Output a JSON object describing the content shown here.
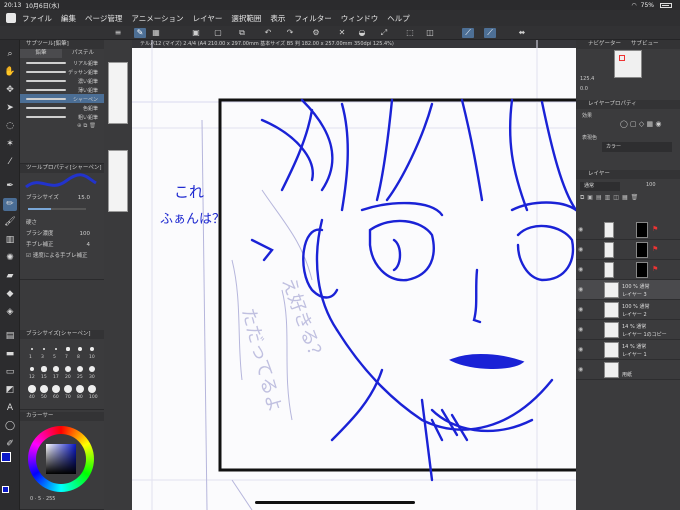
{
  "status": {
    "time": "20:13",
    "date": "10月6日(水)",
    "battery": "75%"
  },
  "menu": [
    "ファイル",
    "編集",
    "ページ管理",
    "アニメーション",
    "レイヤー",
    "選択範囲",
    "表示",
    "フィルター",
    "ウィンドウ",
    "ヘルプ"
  ],
  "doc_tab": "テルバ12 (マイズ) 2.4/4 (A4 210.00 x 297.00mm 基本サイズ B5 判 182.00 x 257.00mm 350dpi 125.4%)",
  "subtool_panel": {
    "title": "サブツール[鉛筆]",
    "tabs": [
      "鉛筆",
      "パステル"
    ],
    "brushes": [
      "リアル鉛筆",
      "デッサン鉛筆",
      "濃い鉛筆",
      "薄い鉛筆",
      "シャーペン",
      "色鉛筆",
      "粗い鉛筆"
    ]
  },
  "tool_property": {
    "title": "ツールプロパティ[シャーペン]",
    "brush_size_label": "ブラシサイズ",
    "brush_size_value": "15.0",
    "hardness_label": "硬さ",
    "density_label": "ブラシ濃度",
    "density_value": "100",
    "stabilization_label": "手ブレ補正",
    "stabilization_value": "4",
    "speed_label": "速度による手ブレ補正"
  },
  "brush_size_panel": {
    "title": "ブラシサイズ[シャーペン]",
    "sizes": [
      "1",
      "3",
      "5",
      "7",
      "8",
      "10",
      "12",
      "15",
      "17",
      "20",
      "25",
      "30",
      "40",
      "50",
      "60",
      "70",
      "80",
      "100"
    ]
  },
  "color_panel": {
    "title": "カラーサー",
    "values": [
      "0",
      "5",
      "255"
    ],
    "main_color": "#0a18c8"
  },
  "navigator": {
    "title": "ナビゲーター",
    "sub": "サブビュー",
    "zoom": "125.4",
    "angle": "0.0"
  },
  "layer_property": {
    "title": "レイヤープロパティ",
    "effect_label": "効果",
    "expression_label": "表現色",
    "expression_value": "カラー"
  },
  "layer_panel": {
    "title": "レイヤー",
    "blend_mode": "通常",
    "opacity": "100",
    "layers": [
      {
        "line1": "",
        "line2": ""
      },
      {
        "line1": "",
        "line2": ""
      },
      {
        "line1": "",
        "line2": ""
      },
      {
        "line1": "100 % 通常",
        "line2": "レイヤー 3"
      },
      {
        "line1": "100 % 通常",
        "line2": "レイヤー 2"
      },
      {
        "line1": "14 % 通常",
        "line2": "レイヤー 1のコピー"
      },
      {
        "line1": "14 % 通常",
        "line2": "レイヤー 1"
      },
      {
        "line1": "",
        "line2": "用紙"
      }
    ]
  },
  "canvas": {
    "annotation_line1": "これ",
    "annotation_line2": "ふぁんは？",
    "pencil_text1": "え好きる？",
    "pencil_text2": "ただってるよ"
  }
}
